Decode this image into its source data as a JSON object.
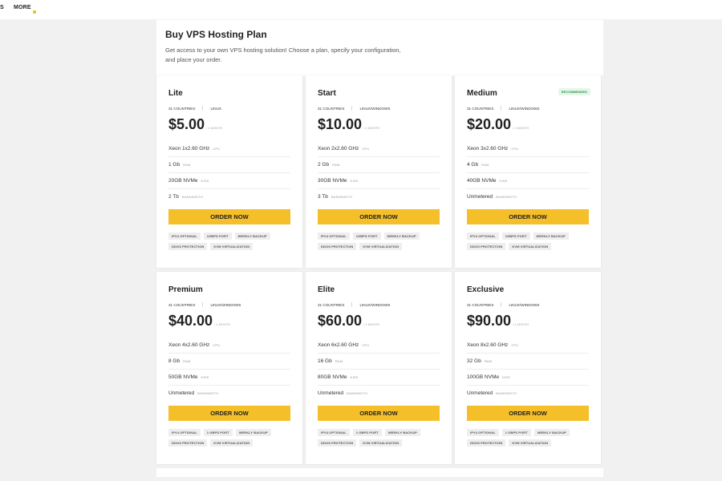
{
  "nav": {
    "partial_item": "S",
    "more_label": "MORE"
  },
  "page": {
    "title": "Buy VPS Hosting Plan",
    "intro": "Get access to your own VPS hosting solution! Choose a plan, specify your configuration, and place your order."
  },
  "labels": {
    "cpu": "CPU",
    "ram": "RAM",
    "disk": "DISK",
    "bandwidth": "BANDWIDTH",
    "period": "/ 1 MONTH",
    "order": "ORDER NOW"
  },
  "colors": {
    "accent": "#f5bf2a",
    "badge_green": "#2a9a47"
  },
  "plans": [
    {
      "name": "Lite",
      "badge": "",
      "countries": "31 COUNTRIES",
      "os": "LINUX",
      "price": "$5.00",
      "cpu": "Xeon 1x2.60 GHz",
      "ram": "1 Gb",
      "disk": "20GB NVMe",
      "bandwidth": "2 Tb",
      "tags": [
        "IPV4 OPTIONAL",
        "1GBPS PORT",
        "WEEKLY BACKUP",
        "DDOS PROTECTION",
        "KVM VIRTUALIZATION"
      ]
    },
    {
      "name": "Start",
      "badge": "",
      "countries": "31 COUNTRIES",
      "os": "LINUX/WINDOWS",
      "price": "$10.00",
      "cpu": "Xeon 2x2.60 GHz",
      "ram": "2 Gb",
      "disk": "30GB NVMe",
      "bandwidth": "3 Tb",
      "tags": [
        "IPV4 OPTIONAL",
        "1GBPS PORT",
        "WEEKLY BACKUP",
        "DDOS PROTECTION",
        "KVM VIRTUALIZATION"
      ]
    },
    {
      "name": "Medium",
      "badge": "RECOMMENDED",
      "countries": "31 COUNTRIES",
      "os": "LINUX/WINDOWS",
      "price": "$20.00",
      "cpu": "Xeon 3x2.60 GHz",
      "ram": "4 Gb",
      "disk": "40GB NVMe",
      "bandwidth": "Unmetered",
      "tags": [
        "IPV4 OPTIONAL",
        "1GBPS PORT",
        "WEEKLY BACKUP",
        "DDOS PROTECTION",
        "KVM VIRTUALIZATION"
      ]
    },
    {
      "name": "Premium",
      "badge": "",
      "countries": "31 COUNTRIES",
      "os": "LINUX/WINDOWS",
      "price": "$40.00",
      "cpu": "Xeon 4x2.60 GHz",
      "ram": "8 Gb",
      "disk": "50GB NVMe",
      "bandwidth": "Unmetered",
      "tags": [
        "IPV4 OPTIONAL",
        "1 GBPS PORT",
        "WEEKLY BACKUP",
        "DDOS PROTECTION",
        "KVM VIRTUALIZATION"
      ]
    },
    {
      "name": "Elite",
      "badge": "",
      "countries": "31 COUNTRIES",
      "os": "LINUX/WINDOWS",
      "price": "$60.00",
      "cpu": "Xeon 6x2.60 GHz",
      "ram": "16 Gb",
      "disk": "80GB NVMe",
      "bandwidth": "Unmetered",
      "tags": [
        "IPV4 OPTIONAL",
        "1 GBPS PORT",
        "WEEKLY BACKUP",
        "DDOS PROTECTION",
        "KVM VIRTUALIZATION"
      ]
    },
    {
      "name": "Exclusive",
      "badge": "",
      "countries": "31 COUNTRIES",
      "os": "LINUX/WINDOWS",
      "price": "$90.00",
      "cpu": "Xeon 8x2.60 GHz",
      "ram": "32 Gb",
      "disk": "100GB NVMe",
      "bandwidth": "Unmetered",
      "tags": [
        "IPV4 OPTIONAL",
        "1 GBPS PORT",
        "WEEKLY BACKUP",
        "DDOS PROTECTION",
        "KVM VIRTUALIZATION"
      ]
    }
  ]
}
